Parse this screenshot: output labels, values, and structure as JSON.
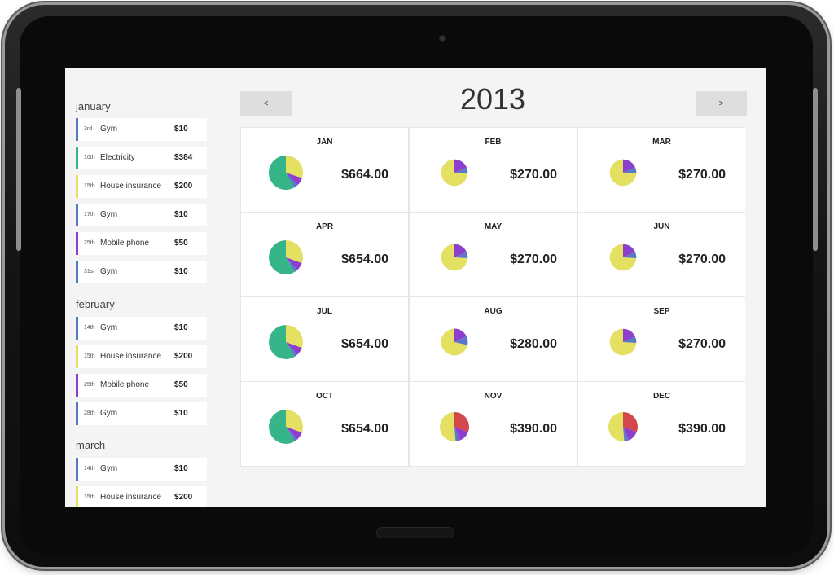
{
  "year": "2013",
  "nav": {
    "prev_label": "<",
    "next_label": ">"
  },
  "colors": {
    "green": "#35b588",
    "yellow": "#e3e062",
    "purple": "#8e3ecc",
    "blue": "#5a78c8",
    "red": "#d2484c"
  },
  "sidebar": {
    "months": [
      {
        "name": "january",
        "items": [
          {
            "day": "3rd",
            "name": "Gym",
            "amount": "$10",
            "color": "#5a78c8"
          },
          {
            "day": "10th",
            "name": "Electricity",
            "amount": "$384",
            "color": "#35b588"
          },
          {
            "day": "15th",
            "name": "House insurance",
            "amount": "$200",
            "color": "#e3e062"
          },
          {
            "day": "17th",
            "name": "Gym",
            "amount": "$10",
            "color": "#5a78c8"
          },
          {
            "day": "25th",
            "name": "Mobile phone",
            "amount": "$50",
            "color": "#8e3ecc"
          },
          {
            "day": "31st",
            "name": "Gym",
            "amount": "$10",
            "color": "#5a78c8"
          }
        ]
      },
      {
        "name": "february",
        "items": [
          {
            "day": "14th",
            "name": "Gym",
            "amount": "$10",
            "color": "#5a78c8"
          },
          {
            "day": "15th",
            "name": "House insurance",
            "amount": "$200",
            "color": "#e3e062"
          },
          {
            "day": "25th",
            "name": "Mobile phone",
            "amount": "$50",
            "color": "#8e3ecc"
          },
          {
            "day": "28th",
            "name": "Gym",
            "amount": "$10",
            "color": "#5a78c8"
          }
        ]
      },
      {
        "name": "march",
        "items": [
          {
            "day": "14th",
            "name": "Gym",
            "amount": "$10",
            "color": "#5a78c8"
          },
          {
            "day": "15th",
            "name": "House insurance",
            "amount": "$200",
            "color": "#e3e062"
          }
        ]
      }
    ]
  },
  "months": [
    {
      "name": "JAN",
      "total": "$664.00",
      "slices": [
        {
          "color": "#35b588",
          "value": 384
        },
        {
          "color": "#e3e062",
          "value": 200
        },
        {
          "color": "#8e3ecc",
          "value": 50
        },
        {
          "color": "#5a78c8",
          "value": 30
        }
      ]
    },
    {
      "name": "FEB",
      "total": "$270.00",
      "slices": [
        {
          "color": "#e3e062",
          "value": 200
        },
        {
          "color": "#8e3ecc",
          "value": 50
        },
        {
          "color": "#5a78c8",
          "value": 20
        }
      ]
    },
    {
      "name": "MAR",
      "total": "$270.00",
      "slices": [
        {
          "color": "#e3e062",
          "value": 200
        },
        {
          "color": "#8e3ecc",
          "value": 50
        },
        {
          "color": "#5a78c8",
          "value": 20
        }
      ]
    },
    {
      "name": "APR",
      "total": "$654.00",
      "slices": [
        {
          "color": "#35b588",
          "value": 384
        },
        {
          "color": "#e3e062",
          "value": 200
        },
        {
          "color": "#8e3ecc",
          "value": 50
        },
        {
          "color": "#5a78c8",
          "value": 20
        }
      ]
    },
    {
      "name": "MAY",
      "total": "$270.00",
      "slices": [
        {
          "color": "#e3e062",
          "value": 200
        },
        {
          "color": "#8e3ecc",
          "value": 50
        },
        {
          "color": "#5a78c8",
          "value": 20
        }
      ]
    },
    {
      "name": "JUN",
      "total": "$270.00",
      "slices": [
        {
          "color": "#e3e062",
          "value": 200
        },
        {
          "color": "#8e3ecc",
          "value": 50
        },
        {
          "color": "#5a78c8",
          "value": 20
        }
      ]
    },
    {
      "name": "JUL",
      "total": "$654.00",
      "slices": [
        {
          "color": "#35b588",
          "value": 384
        },
        {
          "color": "#e3e062",
          "value": 200
        },
        {
          "color": "#8e3ecc",
          "value": 50
        },
        {
          "color": "#5a78c8",
          "value": 20
        }
      ]
    },
    {
      "name": "AUG",
      "total": "$280.00",
      "slices": [
        {
          "color": "#e3e062",
          "value": 200
        },
        {
          "color": "#8e3ecc",
          "value": 50
        },
        {
          "color": "#5a78c8",
          "value": 30
        }
      ]
    },
    {
      "name": "SEP",
      "total": "$270.00",
      "slices": [
        {
          "color": "#e3e062",
          "value": 200
        },
        {
          "color": "#8e3ecc",
          "value": 50
        },
        {
          "color": "#5a78c8",
          "value": 20
        }
      ]
    },
    {
      "name": "OCT",
      "total": "$654.00",
      "slices": [
        {
          "color": "#35b588",
          "value": 384
        },
        {
          "color": "#e3e062",
          "value": 200
        },
        {
          "color": "#8e3ecc",
          "value": 50
        },
        {
          "color": "#5a78c8",
          "value": 20
        }
      ]
    },
    {
      "name": "NOV",
      "total": "$390.00",
      "slices": [
        {
          "color": "#e3e062",
          "value": 200
        },
        {
          "color": "#d2484c",
          "value": 120
        },
        {
          "color": "#8e3ecc",
          "value": 50
        },
        {
          "color": "#5a78c8",
          "value": 20
        }
      ]
    },
    {
      "name": "DEC",
      "total": "$390.00",
      "slices": [
        {
          "color": "#e3e062",
          "value": 200
        },
        {
          "color": "#d2484c",
          "value": 120
        },
        {
          "color": "#8e3ecc",
          "value": 50
        },
        {
          "color": "#5a78c8",
          "value": 20
        }
      ]
    }
  ]
}
